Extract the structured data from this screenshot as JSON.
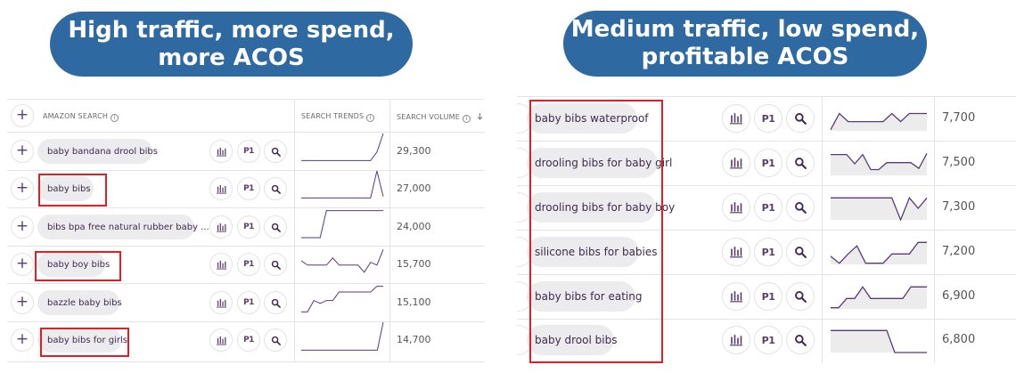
{
  "banners": {
    "left": [
      "High traffic, more spend,",
      "more ACOS"
    ],
    "right": [
      "Medium traffic, low spend,",
      "profitable ACOS"
    ]
  },
  "left_table": {
    "header": {
      "search": "AMAZON SEARCH",
      "trends": "SEARCH TRENDS",
      "volume": "SEARCH VOLUME"
    },
    "rows": [
      {
        "keyword": "baby bandana drool bibs",
        "volume": "29,300",
        "highlighted": false,
        "trend": [
          0.05,
          0.05,
          0.05,
          0.05,
          0.05,
          0.05,
          0.05,
          0.05,
          0.05,
          0.05,
          0.05,
          0.05,
          0.35,
          1.0
        ]
      },
      {
        "keyword": "baby bibs",
        "volume": "27,000",
        "highlighted": true,
        "trend": [
          0.05,
          0.05,
          0.05,
          0.05,
          0.05,
          0.05,
          0.05,
          0.05,
          0.05,
          0.05,
          0.05,
          0.05,
          1.0,
          0.1
        ]
      },
      {
        "keyword": "bibs bpa free natural rubber baby ...",
        "volume": "24,000",
        "highlighted": false,
        "trend": [
          0.0,
          0.0,
          0.0,
          0.0,
          0.95,
          0.95,
          0.95,
          0.95,
          0.95,
          0.95,
          0.95,
          0.95,
          0.95,
          0.95
        ]
      },
      {
        "keyword": "baby boy bibs",
        "volume": "15,700",
        "highlighted": true,
        "trend": [
          0.5,
          0.35,
          0.35,
          0.35,
          0.35,
          0.6,
          0.35,
          0.35,
          0.35,
          0.35,
          0.1,
          0.45,
          0.35,
          0.9
        ]
      },
      {
        "keyword": "bazzle baby bibs",
        "volume": "15,100",
        "highlighted": false,
        "trend": [
          0.05,
          0.05,
          0.45,
          0.35,
          0.45,
          0.45,
          0.75,
          0.75,
          0.75,
          0.75,
          0.75,
          0.75,
          0.95,
          0.95
        ]
      },
      {
        "keyword": "baby bibs for girls",
        "volume": "14,700",
        "highlighted": true,
        "trend": [
          0.02,
          0.02,
          0.02,
          0.02,
          0.02,
          0.02,
          0.02,
          0.02,
          0.02,
          0.02,
          0.02,
          0.02,
          0.02,
          0.02,
          1.0
        ]
      }
    ]
  },
  "right_table": {
    "rows": [
      {
        "keyword": "baby bibs waterproof",
        "volume": "7,700",
        "trend": [
          0.05,
          0.75,
          0.4,
          0.4,
          0.4,
          0.4,
          0.4,
          0.75,
          0.4,
          0.75,
          0.75,
          0.75
        ]
      },
      {
        "keyword": "drooling bibs for baby girl",
        "volume": "7,500",
        "trend": [
          0.9,
          0.9,
          0.9,
          0.5,
          0.9,
          0.25,
          0.25,
          0.55,
          0.55,
          0.55,
          0.55,
          0.3,
          0.95
        ]
      },
      {
        "keyword": "drooling bibs for baby boy",
        "volume": "7,300",
        "trend": [
          0.95,
          0.95,
          0.95,
          0.95,
          0.95,
          0.95,
          0.95,
          0.95,
          0.0,
          0.95,
          0.5,
          0.95
        ]
      },
      {
        "keyword": "silicone bibs for babies",
        "volume": "7,200",
        "trend": [
          0.35,
          0.05,
          0.45,
          0.8,
          0.05,
          0.05,
          0.05,
          0.45,
          0.45,
          0.45,
          0.95,
          0.95
        ]
      },
      {
        "keyword": "baby bibs for eating",
        "volume": "6,900",
        "trend": [
          0.05,
          0.05,
          0.45,
          0.45,
          0.95,
          0.45,
          0.45,
          0.45,
          0.45,
          0.45,
          0.95,
          0.95,
          0.95
        ]
      },
      {
        "keyword": "baby drool bibs",
        "volume": "6,800",
        "trend": [
          0.95,
          0.95,
          0.95,
          0.95,
          0.95,
          0.95,
          0.95,
          0.95,
          0.0,
          0.0,
          0.0,
          0.0,
          0.0
        ]
      }
    ]
  },
  "buttons": {
    "add": "+",
    "rank": "P1"
  },
  "icons": [
    "plus-icon",
    "bar-chart-icon",
    "rank-icon",
    "search-icon",
    "info-icon",
    "sort-down-icon"
  ],
  "colors": {
    "banner": "#2e6aa1",
    "highlight": "#e51c23",
    "spark_line": "#5a3a78",
    "spark_fill": "#ececec",
    "chip": "#ececee"
  }
}
